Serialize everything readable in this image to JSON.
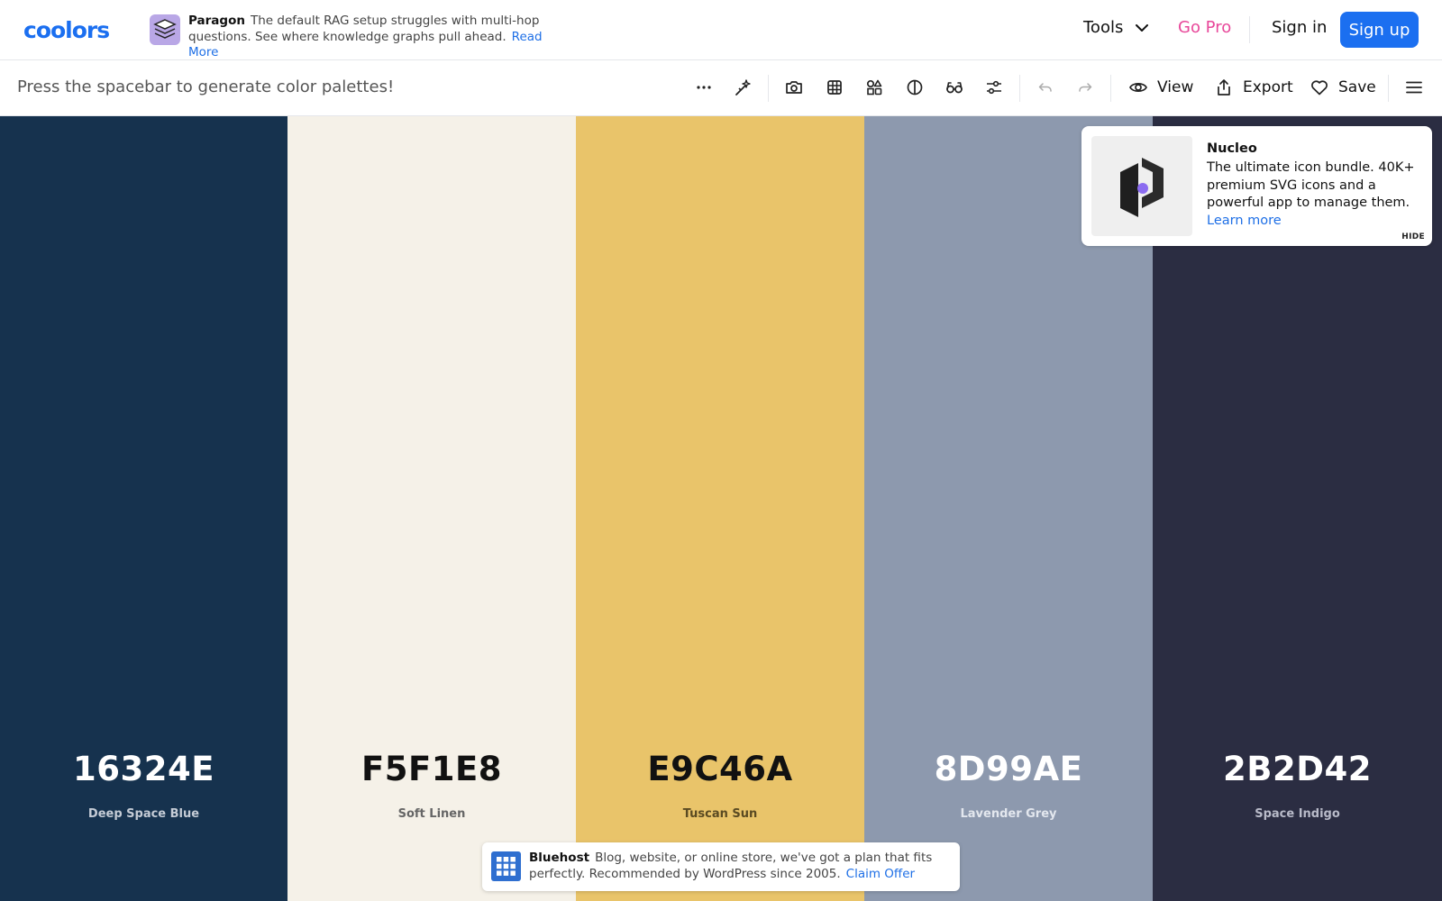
{
  "header": {
    "logo_text": "coolors",
    "ad": {
      "brand": "Paragon",
      "text": "The default RAG setup struggles with multi-hop questions. See where knowledge graphs pull ahead.",
      "link": "Read More"
    },
    "nav": {
      "tools": "Tools",
      "go_pro": "Go Pro",
      "sign_in": "Sign in",
      "sign_up": "Sign up"
    }
  },
  "toolbar": {
    "hint": "Press the spacebar to generate color palettes!",
    "icons": [
      "more-icon",
      "magic-icon",
      "camera-icon",
      "grid-icon",
      "shapes-icon",
      "contrast-icon",
      "glasses-icon",
      "sliders-icon",
      "undo-icon",
      "redo-icon"
    ],
    "view_label": "View",
    "export_label": "Export",
    "save_label": "Save"
  },
  "palette": [
    {
      "hex": "16324E",
      "name": "Deep Space Blue",
      "bg": "#16324E",
      "text_color": "#FFFFFF",
      "name_color": "#C5CCD6"
    },
    {
      "hex": "F5F1E8",
      "name": "Soft Linen",
      "bg": "#F5F1E8",
      "text_color": "#111111",
      "name_color": "#666666"
    },
    {
      "hex": "E9C46A",
      "name": "Tuscan Sun",
      "bg": "#E9C46A",
      "text_color": "#111111",
      "name_color": "#5a4a22"
    },
    {
      "hex": "8D99AE",
      "name": "Lavender Grey",
      "bg": "#8D99AE",
      "text_color": "#FFFFFF",
      "name_color": "#E3E7EE"
    },
    {
      "hex": "2B2D42",
      "name": "Space Indigo",
      "bg": "#2B2D42",
      "text_color": "#FFFFFF",
      "name_color": "#B9BBC9"
    }
  ],
  "nucleo_ad": {
    "title": "Nucleo",
    "body": "The ultimate icon bundle. 40K+ premium SVG icons and a powerful app to manage them.",
    "link": "Learn more",
    "hide": "HIDE"
  },
  "bluehost_ad": {
    "brand": "Bluehost",
    "text": "Blog, website, or online store, we've got a plan that fits perfectly. Recommended by WordPress since 2005.",
    "link": "Claim Offer"
  },
  "colors": {
    "accent": "#1B6FF0",
    "gopro": "#E8489A",
    "link": "#1E6FE6"
  }
}
